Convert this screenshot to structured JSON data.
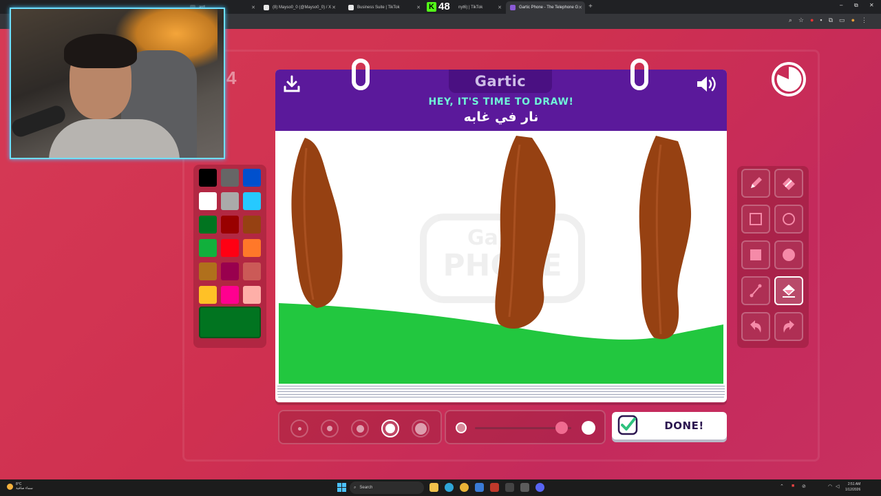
{
  "browser": {
    "tabs": [
      {
        "title": "ard",
        "active": false,
        "favicon_color": "#4a4a4a"
      },
      {
        "title": "(8) Mayso0_0 (@Mayso0_0) / X",
        "active": false,
        "favicon_color": "#e8e8e8"
      },
      {
        "title": "Business Suite | TikTok",
        "active": false,
        "favicon_color": "#e8e8e8"
      },
      {
        "title": "nyt6) | TikTok",
        "active": false,
        "favicon_color": "#e8e8e8"
      },
      {
        "title": "Gartic Phone - The Telephone G",
        "active": true,
        "favicon_color": "#8a5ad6"
      }
    ],
    "new_tab_label": "+",
    "kick_badge": {
      "letter": "K",
      "count": "48"
    },
    "window_controls": [
      "–",
      "⧉",
      "✕"
    ]
  },
  "game": {
    "logo": "Gartic",
    "prompt": "HEY, IT'S TIME TO DRAW!",
    "word": "نار في غابه",
    "round_number": "4",
    "done_label": "DONE!",
    "palette": {
      "colors": [
        "#000000",
        "#666666",
        "#0050cd",
        "#ffffff",
        "#aaaaaa",
        "#26c9ff",
        "#017420",
        "#990000",
        "#964112",
        "#11b03c",
        "#ff0013",
        "#ff7829",
        "#b0701c",
        "#99004e",
        "#cb5a57",
        "#ffc126",
        "#ff008f",
        "#feafa8"
      ],
      "current_color": "#017420"
    },
    "tools": [
      "pen-icon",
      "eraser-icon",
      "rect-outline-icon",
      "ellipse-outline-icon",
      "rect-fill-icon",
      "ellipse-fill-icon",
      "line-icon",
      "fill-bucket-icon",
      "undo-icon",
      "redo-icon"
    ],
    "selected_tool": "fill-bucket-icon",
    "brush_sizes": [
      1,
      2,
      3,
      4,
      5
    ],
    "selected_brush_size": 4,
    "opacity_level": 0.9,
    "colors": {
      "header": "#5b199b",
      "prompt": "#6ff3d8",
      "tree": "#964112",
      "grass": "#22c73f"
    }
  },
  "taskbar": {
    "weather_temp": "8°C",
    "weather_desc": "سماء صافية",
    "search_placeholder": "Search",
    "time": "2:51 AM",
    "date": "1/12/2026"
  }
}
